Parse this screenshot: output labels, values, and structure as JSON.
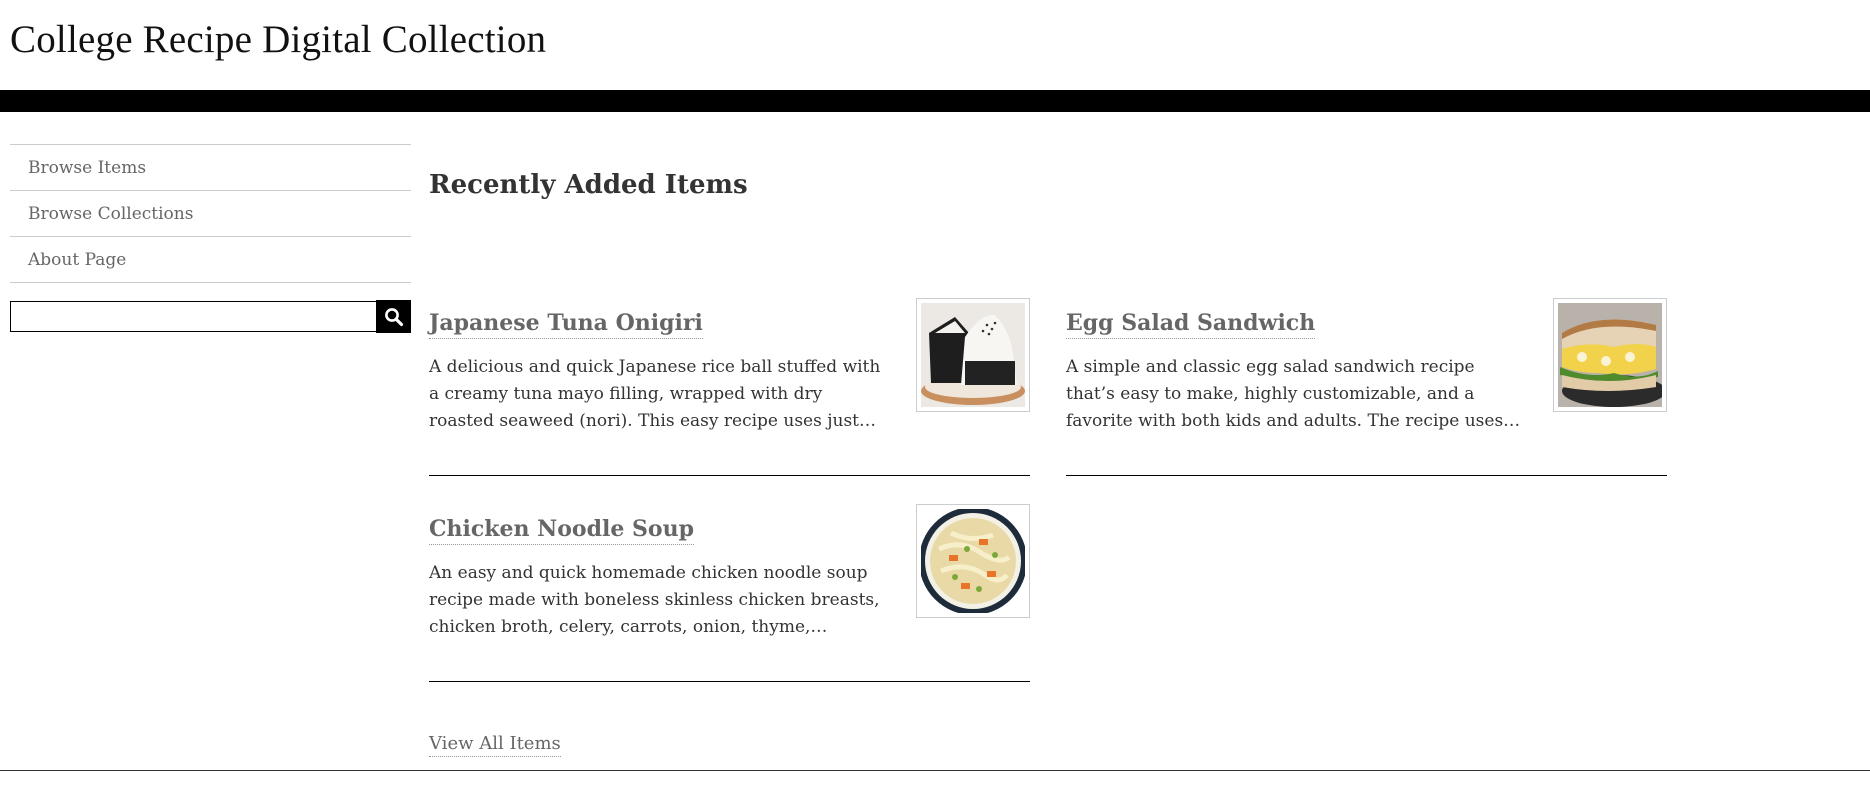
{
  "site": {
    "title": "College Recipe Digital Collection"
  },
  "sidebar": {
    "nav": [
      {
        "label": "Browse Items"
      },
      {
        "label": "Browse Collections"
      },
      {
        "label": "About Page"
      }
    ],
    "search": {
      "value": "",
      "placeholder": "",
      "button_icon": "search-icon"
    }
  },
  "main": {
    "section_title": "Recently Added Items",
    "items": [
      {
        "title": "Japanese Tuna Onigiri",
        "description": "A delicious and quick Japanese rice ball stuffed with a creamy tuna mayo filling, wrapped with dry roasted seaweed (nori). This easy recipe uses just…",
        "thumbnail": "onigiri-photo"
      },
      {
        "title": "Egg Salad Sandwich",
        "description": "A simple and classic egg salad sandwich recipe that’s easy to make, highly customizable, and a favorite with both kids and adults. The recipe uses…",
        "thumbnail": "sandwich-photo"
      },
      {
        "title": "Chicken Noodle Soup",
        "description": "An easy and quick homemade chicken noodle soup recipe made with boneless skinless chicken breasts, chicken broth, celery, carrots, onion, thyme,…",
        "thumbnail": "soup-photo"
      }
    ],
    "view_all_label": "View All Items"
  },
  "colors": {
    "header_bar": "#000000",
    "link": "#666666",
    "text": "#333333"
  }
}
